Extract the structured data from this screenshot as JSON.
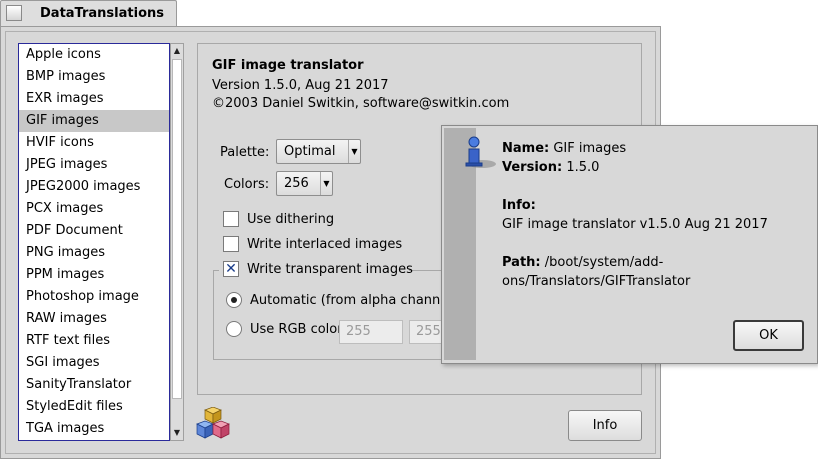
{
  "window": {
    "title": "DataTranslations"
  },
  "list": {
    "items": [
      "Apple icons",
      "BMP images",
      "EXR images",
      "GIF images",
      "HVIF icons",
      "JPEG images",
      "JPEG2000 images",
      "PCX images",
      "PDF Document",
      "PNG images",
      "PPM images",
      "Photoshop image",
      "RAW images",
      "RTF text files",
      "SGI images",
      "SanityTranslator",
      "StyledEdit files",
      "TGA images"
    ],
    "selected_index": 3
  },
  "translator": {
    "name": "GIF image translator",
    "version": "Version 1.5.0, Aug 21 2017",
    "copyright": "©2003 Daniel Switkin, software@switkin.com",
    "palette_label": "Palette:",
    "palette_value": "Optimal",
    "colors_label": "Colors:",
    "colors_value": "256",
    "use_dithering": "Use dithering",
    "write_interlaced": "Write interlaced images",
    "write_transparent": "Write transparent images",
    "automatic_label": "Automatic (from alpha channel)",
    "use_rgb_label": "Use RGB color",
    "rgb_r": "255",
    "rgb_g": "255"
  },
  "info_button": "Info",
  "dialog": {
    "name_label": "Name:",
    "name_value": "GIF images",
    "version_label": "Version:",
    "version_value": "1.5.0",
    "info_label": "Info:",
    "info_value": "GIF image translator v1.5.0 Aug 21 2017",
    "path_label": "Path:",
    "path_value_line1": "/boot/system/add-",
    "path_value_line2": "ons/Translators/GIFTranslator",
    "ok_label": "OK"
  },
  "icons": {
    "app_icon": "datatranslations-cubes-icon",
    "dialog_icon": "info-person-icon"
  },
  "colors": {
    "list_border": "#2a2a9a",
    "selection": "#c8c8c8",
    "window_bg": "#d8d8d8",
    "check_mark": "#1a3d8a"
  }
}
